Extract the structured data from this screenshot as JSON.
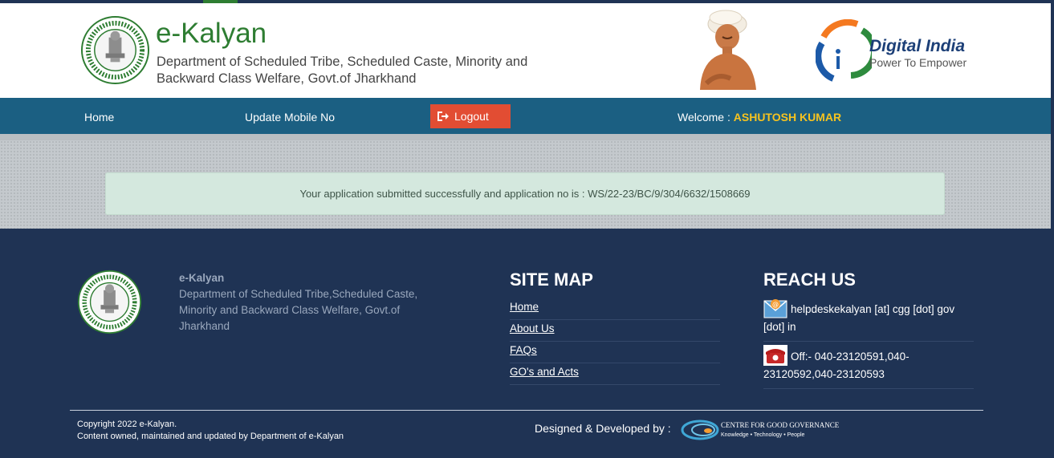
{
  "header": {
    "title": "e-Kalyan",
    "subtitle": "Department of Scheduled Tribe, Scheduled Caste, Minority and Backward Class Welfare, Govt.of Jharkhand",
    "digital_india": {
      "title": "Digital India",
      "tagline": "Power To Empower"
    }
  },
  "nav": {
    "home": "Home",
    "update_mobile": "Update Mobile No",
    "logout": "Logout",
    "welcome_label": "Welcome :",
    "user_name": "ASHUTOSH KUMAR"
  },
  "alert": {
    "message": "Your application submitted successfully and application no is : WS/22-23/BC/9/304/6632/1508669"
  },
  "footer": {
    "brand_title": "e-Kalyan",
    "brand_desc": "Department of Scheduled Tribe,Scheduled Caste, Minority and Backward Class Welfare, Govt.of Jharkhand",
    "sitemap_heading": "SITE MAP",
    "sitemap_links": [
      "Home",
      "About Us",
      "FAQs",
      "GO's and Acts"
    ],
    "reach_heading": "REACH US",
    "email": "helpdeskekalyan [at] cgg [dot] gov [dot] in",
    "phone": "Off:- 040-23120591,040-23120592,040-23120593",
    "copyright": "Copyright 2022 e-Kalyan.",
    "content_note": "Content owned, maintained and updated by Department of e-Kalyan",
    "designed_by": "Designed & Developed by :",
    "cgg_name": "CENTRE FOR GOOD GOVERNANCE",
    "cgg_tagline": "Knowledge • Technology • People"
  },
  "colors": {
    "nav_bg": "#1b5f82",
    "logout_bg": "#e24d33",
    "footer_bg": "#1f3354",
    "alert_bg": "#d4e8de",
    "brand_green": "#2e7d32",
    "welcome_name": "#f6c31f"
  },
  "icons": {
    "emblem": "jharkhand-emblem-icon",
    "logout": "sign-out-icon",
    "email": "envelope-icon",
    "phone": "telephone-icon"
  }
}
